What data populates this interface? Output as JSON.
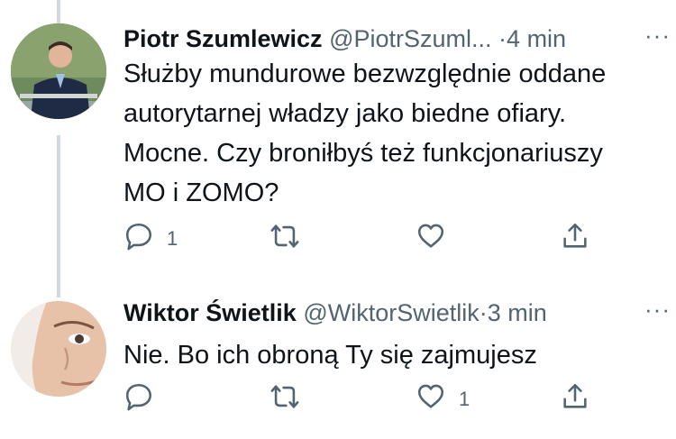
{
  "tweets": [
    {
      "author_name": "Piotr Szumlewicz",
      "handle": "@PiotrSzuml...",
      "separator": "·",
      "time": "4 min",
      "more": "···",
      "text_lines": [
        "Służby mundurowe bezwzględnie oddane",
        "autorytarnej władzy jako biedne ofiary.",
        "Mocne. Czy broniłbyś też funkcjonariuszy",
        "MO i ZOMO?"
      ],
      "reply_count": "1",
      "retweet_count": "",
      "like_count": ""
    },
    {
      "author_name": "Wiktor Świetlik",
      "handle": "@WiktorSwietlik",
      "separator": "·",
      "time": "3 min",
      "more": "···",
      "text_lines": [
        "Nie. Bo ich obroną Ty się zajmujesz"
      ],
      "reply_count": "",
      "retweet_count": "",
      "like_count": "1"
    }
  ],
  "colors": {
    "text": "#0f1419",
    "secondary": "#536471",
    "thread_line": "#cfd9de"
  },
  "icons": [
    "reply-icon",
    "retweet-icon",
    "like-icon",
    "share-icon",
    "more-icon"
  ]
}
